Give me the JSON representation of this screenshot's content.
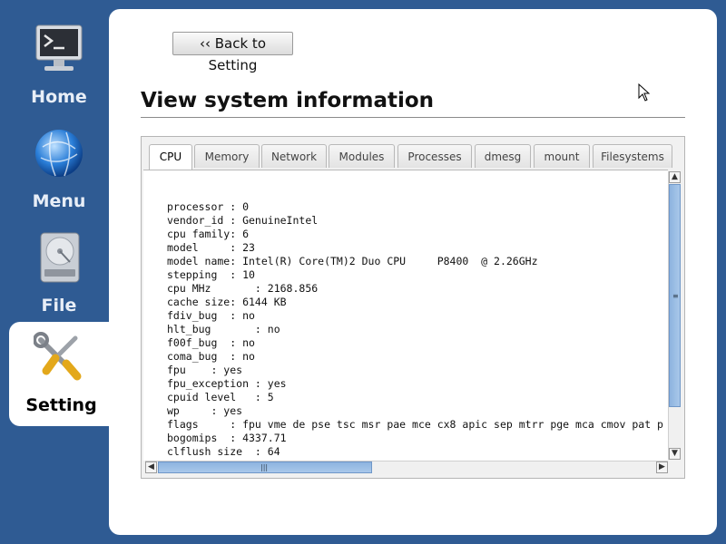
{
  "sidebar": {
    "items": [
      {
        "label": "Home",
        "icon": "terminal-icon"
      },
      {
        "label": "Menu",
        "icon": "globe-icon"
      },
      {
        "label": "File",
        "icon": "hard-drive-icon"
      },
      {
        "label": "Setting",
        "icon": "tools-icon",
        "active": true
      }
    ]
  },
  "main": {
    "back_button": "‹‹ Back to Setting",
    "title": "View system information",
    "tabs": [
      {
        "label": "CPU",
        "active": true
      },
      {
        "label": "Memory"
      },
      {
        "label": "Network"
      },
      {
        "label": "Modules"
      },
      {
        "label": "Processes"
      },
      {
        "label": "dmesg"
      },
      {
        "label": "mount"
      },
      {
        "label": "Filesystems"
      }
    ],
    "content_lines": [
      "processor : 0",
      "vendor_id : GenuineIntel",
      "cpu family: 6",
      "model     : 23",
      "model name: Intel(R) Core(TM)2 Duo CPU     P8400  @ 2.26GHz",
      "stepping  : 10",
      "cpu MHz       : 2168.856",
      "cache size: 6144 KB",
      "fdiv_bug  : no",
      "hlt_bug       : no",
      "f00f_bug  : no",
      "coma_bug  : no",
      "fpu    : yes",
      "fpu_exception : yes",
      "cpuid level   : 5",
      "wp     : yes",
      "flags     : fpu vme de pse tsc msr pae mce cx8 apic sep mtrr pge mca cmov pat p",
      "bogomips  : 4337.71",
      "clflush size  : 64"
    ]
  },
  "colors": {
    "background": "#2f5b93",
    "panel": "#ffffff",
    "scroll_thumb": "#9bbfe6"
  }
}
